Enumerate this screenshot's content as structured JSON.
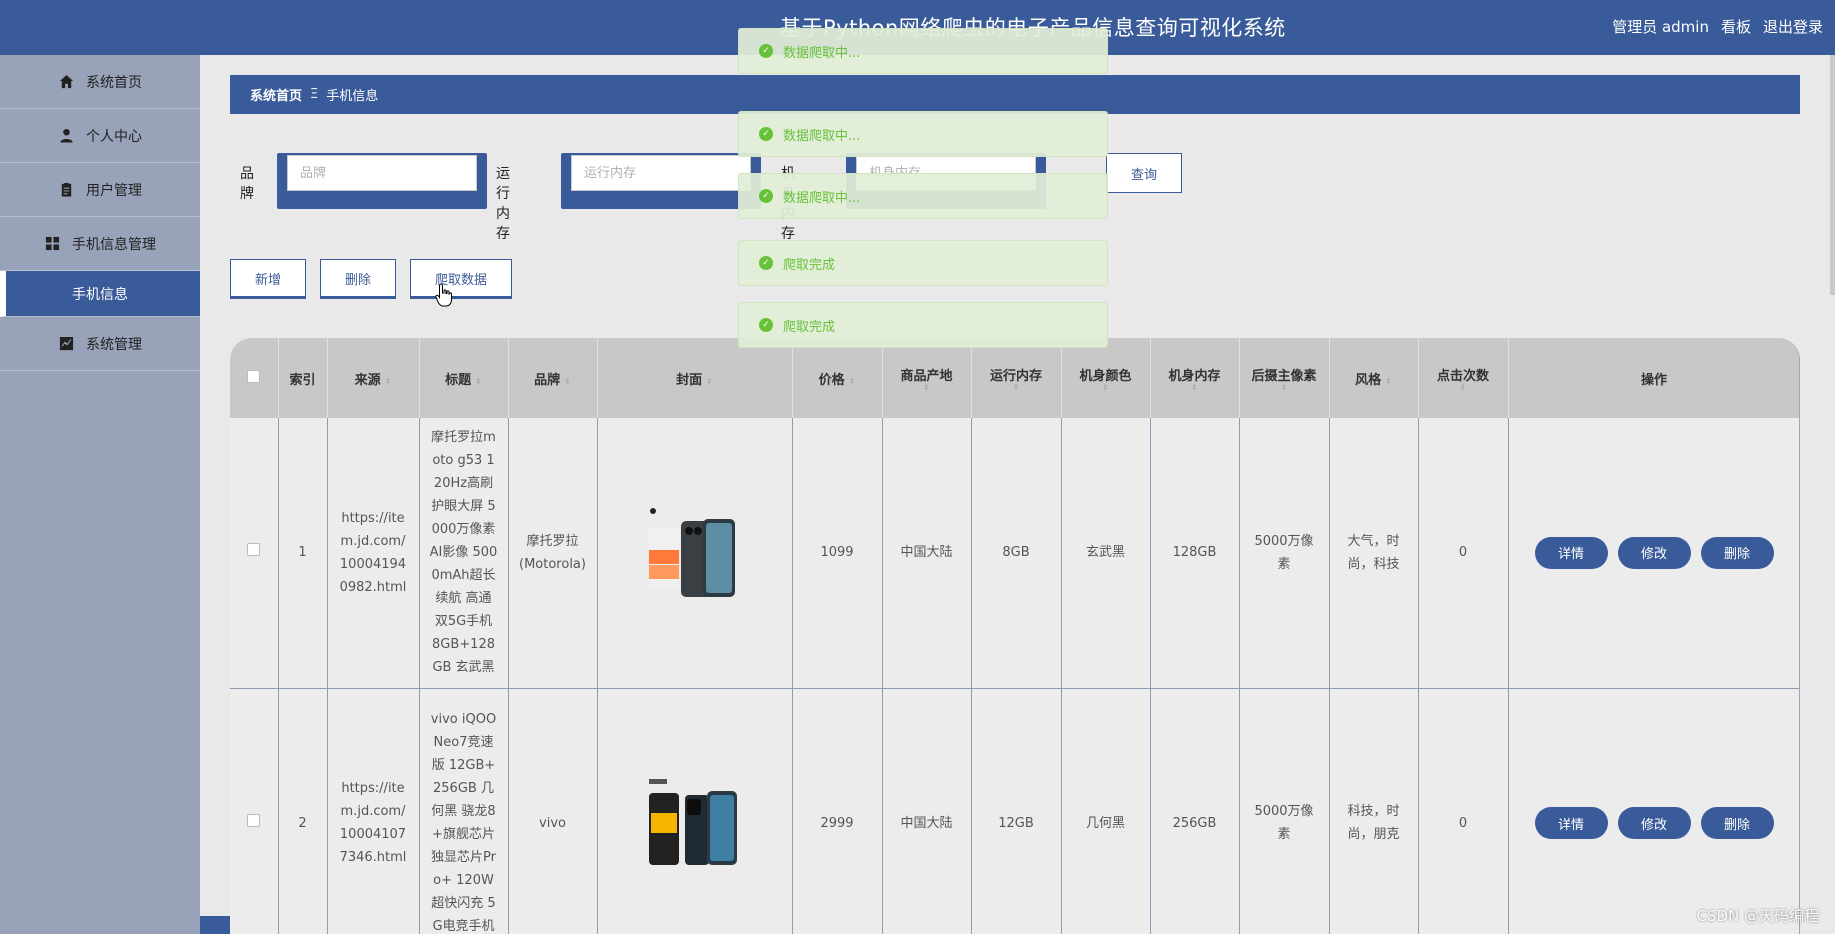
{
  "header": {
    "title": "基于Python网络爬虫的电子产品信息查询可视化系统",
    "admin_label": "管理员 admin",
    "board_label": "看板",
    "logout_label": "退出登录"
  },
  "sidebar": {
    "items": [
      {
        "label": "系统首页",
        "icon": "home-icon"
      },
      {
        "label": "个人中心",
        "icon": "user-icon"
      },
      {
        "label": "用户管理",
        "icon": "clipboard-icon"
      },
      {
        "label": "手机信息管理",
        "icon": "grid-icon"
      },
      {
        "label": "手机信息",
        "icon": ""
      },
      {
        "label": "系统管理",
        "icon": "chart-icon"
      }
    ]
  },
  "breadcrumb": {
    "home": "系统首页",
    "separator": "Ξ",
    "current": "手机信息"
  },
  "search": {
    "brand_label": "品牌",
    "brand_placeholder": "品牌",
    "ram_label": "运行内存",
    "ram_placeholder": "运行内存",
    "rom_label": "机身内存",
    "rom_placeholder": "机身内存",
    "query_label": "查询"
  },
  "actions": {
    "add": "新增",
    "delete": "删除",
    "crawl": "爬取数据"
  },
  "table": {
    "headers": [
      "索引",
      "来源",
      "标题",
      "品牌",
      "封面",
      "价格",
      "商品产地",
      "运行内存",
      "机身颜色",
      "机身内存",
      "后摄主像素",
      "风格",
      "点击次数",
      "操作"
    ],
    "rows": [
      {
        "index": "1",
        "source": "https://item.jd.com/100041940982.html",
        "title": "摩托罗拉moto g53 120Hz高刷护眼大屏 5000万像素AI影像 5000mAh超长续航 高通双5G手机 8GB+128GB 玄武黑",
        "brand": "摩托罗拉(Motorola)",
        "price": "1099",
        "origin": "中国大陆",
        "ram": "8GB",
        "color": "玄武黑",
        "rom": "128GB",
        "camera": "5000万像素",
        "style": "大气，时尚，科技",
        "clicks": "0"
      },
      {
        "index": "2",
        "source": "https://item.jd.com/100041077346.html",
        "title": "vivo iQOO Neo7竞速版 12GB+256GB 几何黑 骁龙8+旗舰芯片 独显芯片Pro+ 120W超快闪充 5G电竞手机",
        "brand": "vivo",
        "price": "2999",
        "origin": "中国大陆",
        "ram": "12GB",
        "color": "几何黑",
        "rom": "256GB",
        "camera": "5000万像素",
        "style": "科技，时尚，朋克",
        "clicks": "0"
      }
    ],
    "ops": {
      "detail": "详情",
      "edit": "修改",
      "remove": "删除"
    }
  },
  "toasts": [
    "数据爬取中...",
    "数据爬取中...",
    "数据爬取中...",
    "爬取完成",
    "爬取完成"
  ],
  "watermark": "CSDN @天码编程",
  "colors": {
    "primary": "#3a5b99",
    "success": "#67c23a",
    "sidebar": "#98a2b8"
  }
}
